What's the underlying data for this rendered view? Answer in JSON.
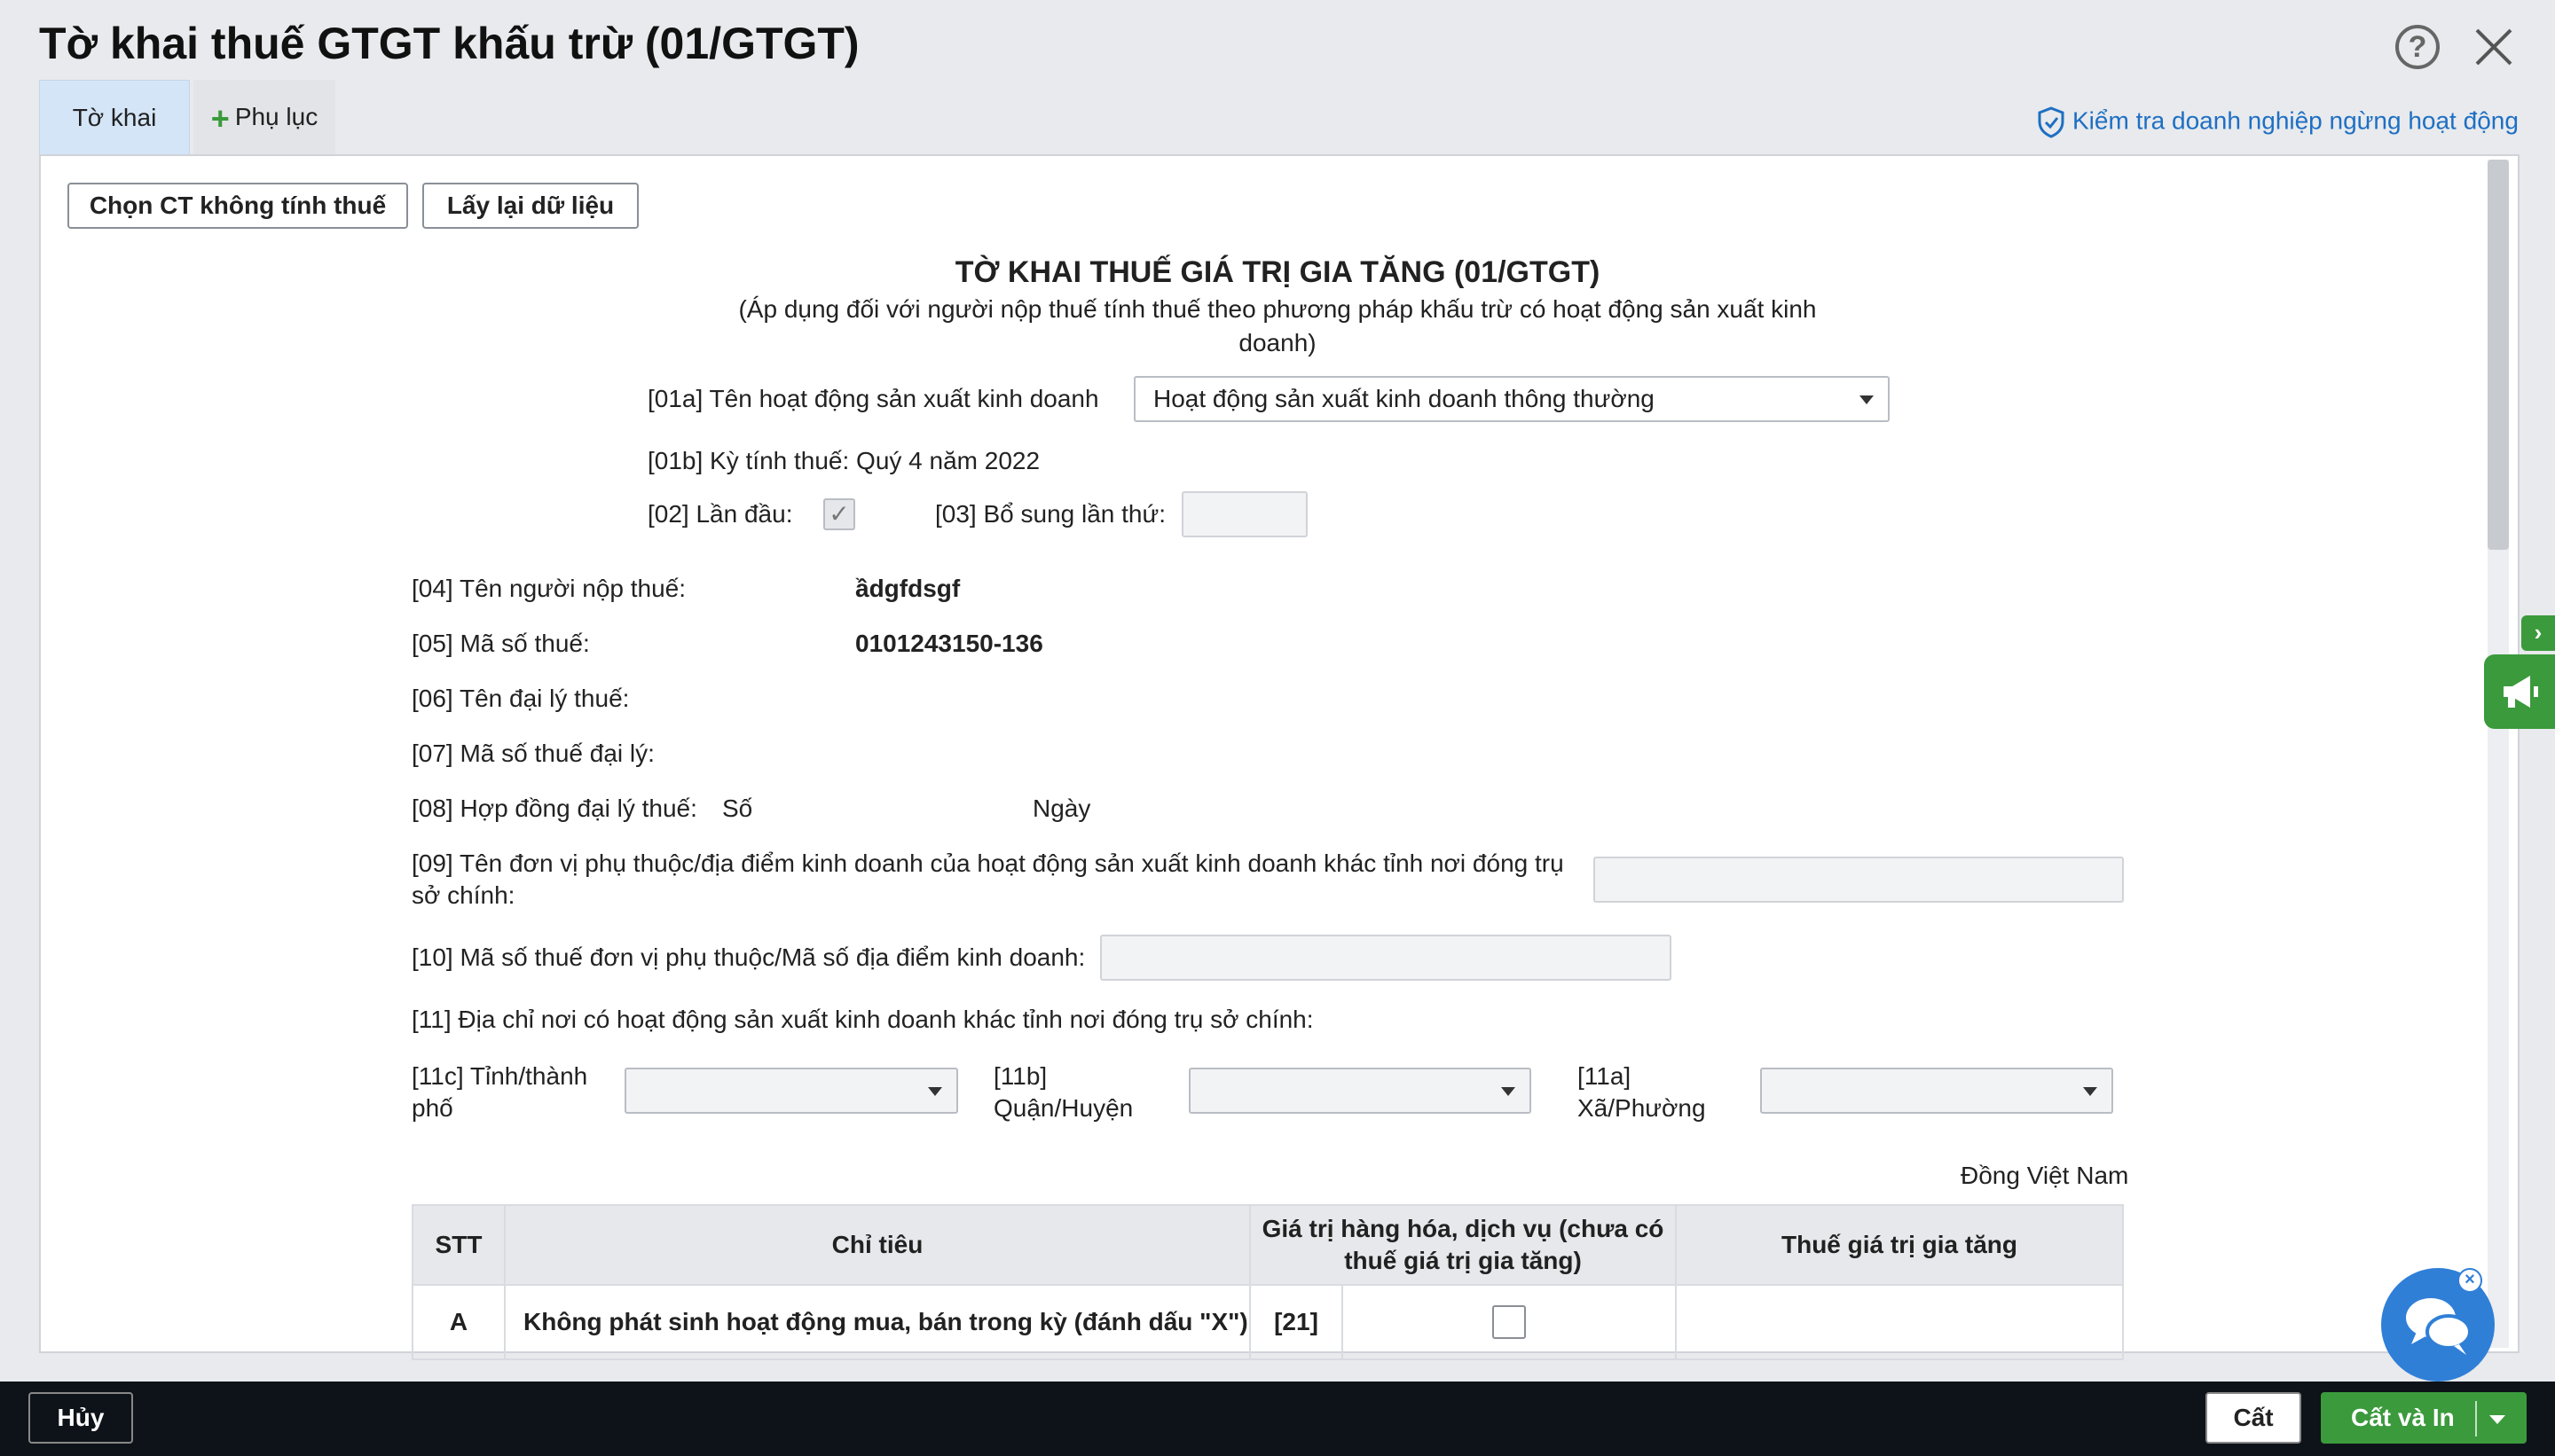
{
  "window": {
    "title": "Tờ khai thuế GTGT khấu trừ (01/GTGT)"
  },
  "tabs": {
    "main_label": "Tờ khai",
    "add_label": "Phụ lục"
  },
  "links": {
    "check_business": "Kiểm tra doanh nghiệp ngừng hoạt động"
  },
  "toolbar": {
    "choose_label": "Chọn CT không tính thuế",
    "reload_label": "Lấy lại dữ liệu"
  },
  "form": {
    "title": "TỜ KHAI THUẾ GIÁ TRỊ GIA TĂNG (01/GTGT)",
    "subtitle_line1": "(Áp dụng đối với người nộp thuế tính thuế theo phương pháp khấu trừ có hoạt động sản xuất kinh",
    "subtitle_line2": "doanh)",
    "f01a_label": "[01a] Tên hoạt động sản xuất kinh doanh",
    "f01a_value": "Hoạt động sản xuất kinh doanh thông thường",
    "f01b_label": "[01b] Kỳ tính thuế: Quý 4 năm 2022",
    "f02_label": "[02] Lần đầu:",
    "f03_label": "[03] Bổ sung lần thứ:",
    "f04_label": "[04] Tên người nộp thuế:",
    "f04_value": "ầdgfdsgf",
    "f05_label": "[05] Mã số thuế:",
    "f05_value": "0101243150-136",
    "f06_label": "[06] Tên đại lý thuế:",
    "f07_label": "[07] Mã số thuế đại lý:",
    "f08_label": "[08] Hợp đồng đại lý thuế:",
    "f08_so": "Số",
    "f08_ngay": "Ngày",
    "f09_label_line1": "[09] Tên đơn vị phụ thuộc/địa điểm kinh doanh của hoạt động sản xuất kinh doanh khác tỉnh nơi đóng trụ",
    "f09_label_line2": "sở chính:",
    "f10_label": "[10] Mã số thuế đơn vị phụ thuộc/Mã số địa điểm kinh doanh:",
    "f11_label": "[11] Địa chỉ nơi có hoạt động sản xuất kinh doanh khác tỉnh nơi đóng trụ sở chính:",
    "f11c_line1": "[11c] Tỉnh/thành",
    "f11c_line2": "phố",
    "f11b_line1": "[11b]",
    "f11b_line2": "Quận/Huyện",
    "f11a_line1": "[11a]",
    "f11a_line2": "Xã/Phường",
    "currency": "Đồng Việt Nam"
  },
  "table": {
    "headers": {
      "stt": "STT",
      "chitieu": "Chỉ tiêu",
      "giatri_line1": "Giá trị hàng hóa, dịch vụ (chưa có",
      "giatri_line2": "thuế giá trị gia tăng)",
      "thue": "Thuế giá trị gia tăng"
    },
    "row_a": {
      "stt": "A",
      "chitieu": "Không phát sinh hoạt động mua, bán trong kỳ (đánh dấu \"X\")",
      "code": "[21]"
    }
  },
  "footer": {
    "cancel_label": "Hủy",
    "save_label": "Cất",
    "save_print_label": "Cất và In"
  },
  "colors": {
    "accent_green": "#3b9a3c",
    "link_blue": "#1e6fc3",
    "chat_blue": "#2f7fd7"
  }
}
